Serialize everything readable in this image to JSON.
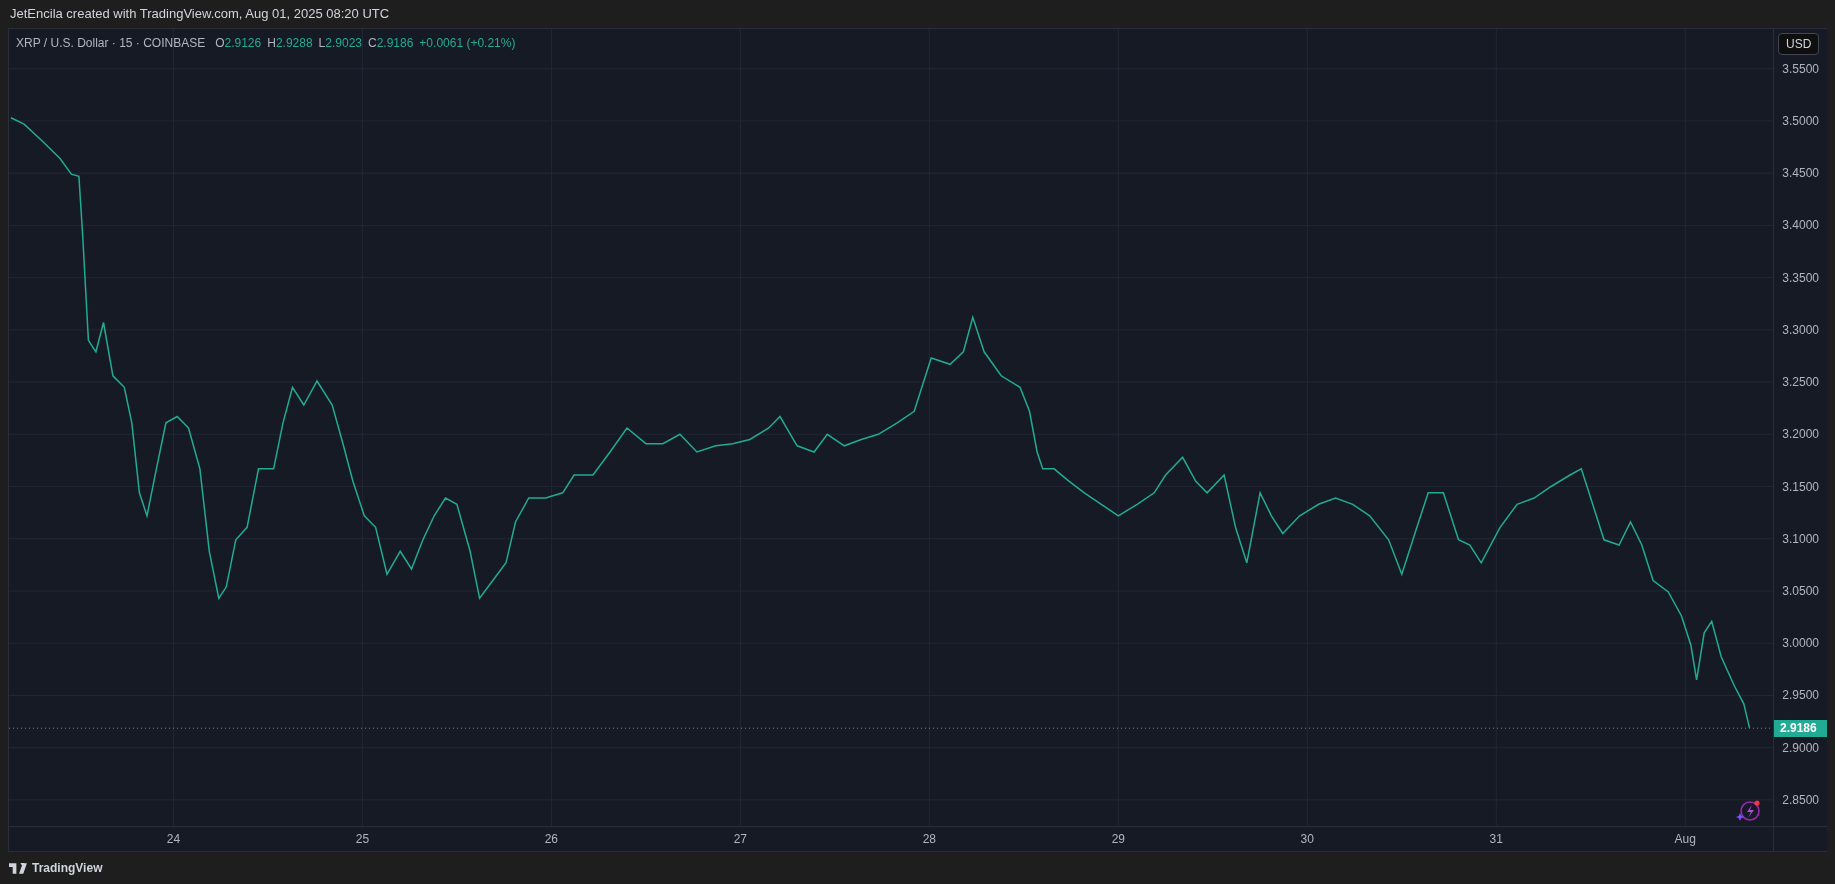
{
  "header": {
    "text": "JetEncila created with TradingView.com, Aug 01, 2025 08:20 UTC"
  },
  "legend": {
    "symbol": "XRP / U.S. Dollar · 15 · COINBASE",
    "ohlc": [
      {
        "label": "O",
        "value": "2.9126"
      },
      {
        "label": "H",
        "value": "2.9288"
      },
      {
        "label": "L",
        "value": "2.9023"
      },
      {
        "label": "C",
        "value": "2.9186"
      }
    ],
    "change": "+0.0061 (+0.21%)"
  },
  "currency_button": "USD",
  "chart_data": {
    "type": "line",
    "x": [
      23.14,
      23.21,
      23.31,
      23.4,
      23.46,
      23.5,
      23.52,
      23.55,
      23.59,
      23.63,
      23.68,
      23.74,
      23.78,
      23.82,
      23.86,
      23.91,
      23.96,
      24.02,
      24.08,
      24.14,
      24.19,
      24.24,
      24.28,
      24.33,
      24.39,
      24.45,
      24.53,
      24.58,
      24.63,
      24.69,
      24.76,
      24.84,
      24.9,
      24.95,
      25.01,
      25.07,
      25.13,
      25.2,
      25.26,
      25.32,
      25.38,
      25.44,
      25.5,
      25.57,
      25.62,
      25.69,
      25.76,
      25.81,
      25.88,
      25.97,
      26.06,
      26.12,
      26.22,
      26.31,
      26.4,
      26.5,
      26.59,
      26.68,
      26.77,
      26.87,
      26.96,
      27.05,
      27.15,
      27.21,
      27.3,
      27.39,
      27.46,
      27.55,
      27.64,
      27.73,
      27.83,
      27.92,
      28.01,
      28.11,
      28.18,
      28.23,
      28.29,
      28.38,
      28.48,
      28.53,
      28.57,
      28.6,
      28.66,
      28.74,
      28.82,
      28.91,
      29.0,
      29.1,
      29.19,
      29.25,
      29.34,
      29.41,
      29.47,
      29.56,
      29.62,
      29.68,
      29.75,
      29.81,
      29.87,
      29.96,
      30.06,
      30.15,
      30.24,
      30.33,
      30.43,
      30.5,
      30.58,
      30.64,
      30.72,
      30.8,
      30.86,
      30.92,
      31.02,
      31.11,
      31.2,
      31.29,
      31.39,
      31.45,
      31.51,
      31.57,
      31.65,
      31.71,
      31.77,
      31.83,
      31.91,
      31.98,
      32.03,
      32.06,
      32.1,
      32.14,
      32.19,
      32.26,
      32.31,
      32.34
    ],
    "series": [
      {
        "color": "#22ab94",
        "values": [
          3.503,
          3.497,
          3.48,
          3.464,
          3.449,
          3.447,
          3.39,
          3.29,
          3.279,
          3.307,
          3.256,
          3.245,
          3.211,
          3.144,
          3.122,
          3.167,
          3.211,
          3.217,
          3.206,
          3.167,
          3.088,
          3.043,
          3.054,
          3.099,
          3.111,
          3.167,
          3.167,
          3.211,
          3.245,
          3.228,
          3.251,
          3.228,
          3.189,
          3.155,
          3.122,
          3.111,
          3.066,
          3.088,
          3.071,
          3.099,
          3.122,
          3.139,
          3.133,
          3.088,
          3.043,
          3.06,
          3.077,
          3.116,
          3.139,
          3.139,
          3.144,
          3.161,
          3.161,
          3.183,
          3.206,
          3.191,
          3.191,
          3.2,
          3.183,
          3.189,
          3.191,
          3.195,
          3.206,
          3.217,
          3.189,
          3.183,
          3.2,
          3.189,
          3.195,
          3.2,
          3.211,
          3.222,
          3.273,
          3.267,
          3.279,
          3.312,
          3.279,
          3.256,
          3.245,
          3.222,
          3.183,
          3.167,
          3.167,
          3.155,
          3.144,
          3.133,
          3.122,
          3.133,
          3.144,
          3.161,
          3.178,
          3.155,
          3.144,
          3.161,
          3.111,
          3.077,
          3.144,
          3.122,
          3.105,
          3.122,
          3.133,
          3.139,
          3.133,
          3.122,
          3.099,
          3.066,
          3.111,
          3.144,
          3.144,
          3.099,
          3.094,
          3.077,
          3.111,
          3.133,
          3.139,
          3.15,
          3.161,
          3.167,
          3.133,
          3.099,
          3.094,
          3.116,
          3.094,
          3.06,
          3.049,
          3.026,
          2.998,
          2.965,
          3.01,
          3.021,
          2.987,
          2.959,
          2.942,
          2.919
        ]
      }
    ],
    "grid": true,
    "ref_lines": [
      {
        "axis": "y",
        "value": 2.9186,
        "label": "2.9186",
        "color": "#22ab94"
      }
    ],
    "xlim": [
      23.13,
      32.75
    ],
    "ylim": [
      2.825,
      3.588
    ],
    "xticks": [
      {
        "value": 24,
        "label": "24"
      },
      {
        "value": 25,
        "label": "25"
      },
      {
        "value": 26,
        "label": "26"
      },
      {
        "value": 27,
        "label": "27"
      },
      {
        "value": 28,
        "label": "28"
      },
      {
        "value": 29,
        "label": "29"
      },
      {
        "value": 30,
        "label": "30"
      },
      {
        "value": 31,
        "label": "31"
      },
      {
        "value": 32,
        "label": "Aug"
      }
    ],
    "yticks": [
      {
        "value": 3.55,
        "label": "3.5500"
      },
      {
        "value": 3.5,
        "label": "3.5000"
      },
      {
        "value": 3.45,
        "label": "3.4500"
      },
      {
        "value": 3.4,
        "label": "3.4000"
      },
      {
        "value": 3.35,
        "label": "3.3500"
      },
      {
        "value": 3.3,
        "label": "3.3000"
      },
      {
        "value": 3.25,
        "label": "3.2500"
      },
      {
        "value": 3.2,
        "label": "3.2000"
      },
      {
        "value": 3.15,
        "label": "3.1500"
      },
      {
        "value": 3.1,
        "label": "3.1000"
      },
      {
        "value": 3.05,
        "label": "3.0500"
      },
      {
        "value": 3.0,
        "label": "3.0000"
      },
      {
        "value": 2.95,
        "label": "2.9500"
      },
      {
        "value": 2.9,
        "label": "2.9000"
      },
      {
        "value": 2.85,
        "label": "2.8500"
      }
    ]
  },
  "footer": {
    "brand": "TradingView"
  }
}
